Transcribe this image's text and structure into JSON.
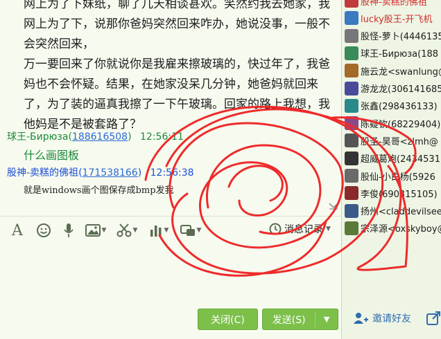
{
  "chat": {
    "message_lines": [
      "网上为了下，说那你爸妈突然回来咋办，她说没事，一般不会突然回来，",
      "万一要回来了你就说你是我雇来擦玻璃的，快过年了，我爸",
      "妈也不会怀疑。结果，在她家没呆几分钟，她爸妈就回来",
      "了，为了装的逼真我擦了一下午玻璃。回家的路上我想，我",
      "他妈是不是被套路了？"
    ],
    "top_line": "网上为了下妹纸，聊了几天相谈甚欢。笑然约我去她家，我",
    "msg1": {
      "sender": "球王-Бирюза",
      "qq": "188616508",
      "time": "12:56:11",
      "text": "什么画图板"
    },
    "msg2": {
      "sender": "股神-卖糕的佛祖",
      "qq": "171538166",
      "time": "12:56:38",
      "text": "就是windows画个图保存成bmp发我"
    },
    "colors": {
      "msg1_sender": "#1a8a3a",
      "msg1_text": "#1a8a3a",
      "msg2_sender": "#1d4fd6",
      "scribble": "#ee2b2b",
      "button": "#7cc04a"
    }
  },
  "toolbar": {
    "icons": [
      "font-icon",
      "emoji-icon",
      "microphone-icon",
      "image-icon",
      "scissors-icon",
      "chart-icon",
      "screen-share-icon"
    ],
    "history_label": "消息记录"
  },
  "buttons": {
    "close": "关闭(C)",
    "send": "发送(S)",
    "send_dropdown": "▼"
  },
  "members": [
    {
      "name": "股神-卖糕的佛祖",
      "color": "#d12b2b"
    },
    {
      "name": "lucky股王-开飞机",
      "color": "#d12b2b"
    },
    {
      "name": "股怪-萝卜(4446135",
      "color": "#1a1a1a"
    },
    {
      "name": "球王-Бирюза(188",
      "color": "#1a1a1a"
    },
    {
      "name": "施云龙<swanlung@",
      "color": "#1a1a1a"
    },
    {
      "name": "游龙龙(306141685",
      "color": "#1a1a1a"
    },
    {
      "name": "张鑫(298436133)",
      "color": "#1a1a1a"
    },
    {
      "name": "陈疑钦(68229404)",
      "color": "#1a1a1a"
    },
    {
      "name": "股圣-昊哥<zlmh@",
      "color": "#1a1a1a"
    },
    {
      "name": "超威葛炮(2434531",
      "color": "#1a1a1a"
    },
    {
      "name": "股仙-小白杨(5926",
      "color": "#1a1a1a"
    },
    {
      "name": "李俊(690315105)",
      "color": "#1a1a1a"
    },
    {
      "name": "扬州<claddevilsee",
      "color": "#1a1a1a"
    },
    {
      "name": "宗泽源<oxskyboy@",
      "color": "#1a1a1a"
    }
  ],
  "invite_label": "邀请好友"
}
